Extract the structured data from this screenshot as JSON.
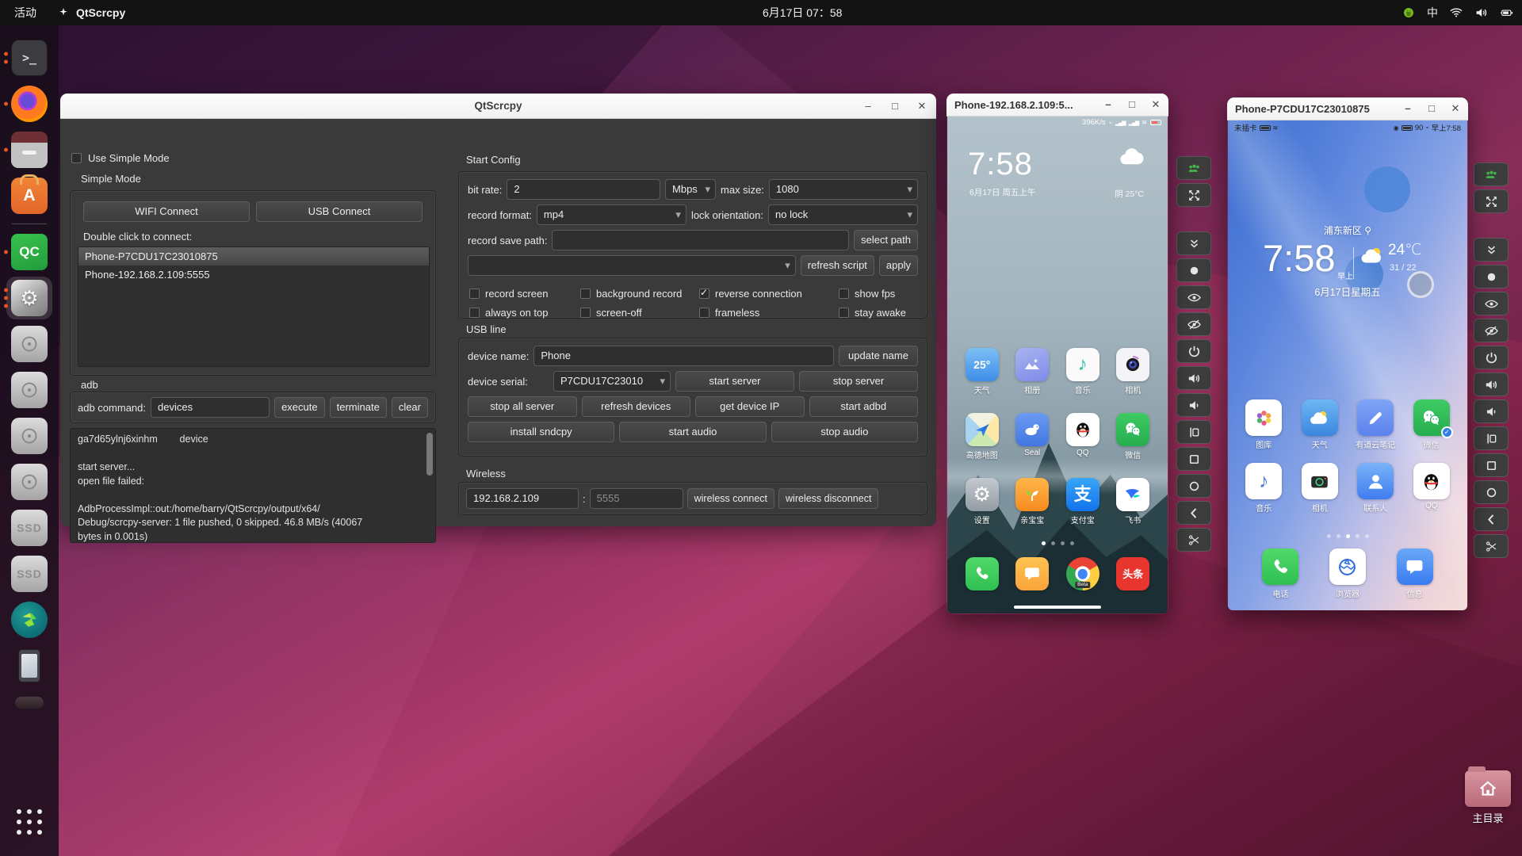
{
  "topbar": {
    "activities_label": "活动",
    "app_name": "QtScrcpy",
    "clock": "6月17日 07：58",
    "ime_label": "中",
    "tray_icons": [
      "android-status-icon",
      "ime-icon",
      "wifi-icon",
      "volume-icon",
      "battery-icon"
    ]
  },
  "dock": {
    "items": [
      {
        "id": "terminal",
        "type": "terminal",
        "dots": 2
      },
      {
        "id": "firefox",
        "type": "firefox",
        "dots": 1
      },
      {
        "id": "files",
        "type": "files",
        "dots": 1
      },
      {
        "id": "ubuntu-software",
        "type": "soft",
        "label": "A",
        "dots": 0
      },
      {
        "id": "divider",
        "type": "divider",
        "dots": 0
      },
      {
        "id": "qtscrcpy-qc",
        "type": "qc",
        "label": "QC",
        "dots": 1
      },
      {
        "id": "settings",
        "type": "gear",
        "dots": 3,
        "active": true
      },
      {
        "id": "disk-1",
        "type": "disk",
        "dots": 0
      },
      {
        "id": "disk-2",
        "type": "disk",
        "dots": 0
      },
      {
        "id": "disk-3",
        "type": "disk",
        "dots": 0
      },
      {
        "id": "disk-4",
        "type": "disk",
        "dots": 0
      },
      {
        "id": "ssd-1",
        "type": "ssd",
        "label": "SSD",
        "dots": 0
      },
      {
        "id": "ssd-2",
        "type": "ssd",
        "label": "SSD",
        "dots": 0
      },
      {
        "id": "remote-app",
        "type": "remote",
        "dots": 0
      },
      {
        "id": "phone-device",
        "type": "phonedev",
        "dots": 0
      },
      {
        "id": "drive-pill",
        "type": "pill",
        "dots": 0
      },
      {
        "id": "app-grid",
        "type": "grid",
        "dots": 0
      }
    ]
  },
  "qtscrcpy": {
    "title": "QtScrcpy",
    "left": {
      "use_simple_mode": "Use Simple Mode",
      "simple_mode_label": "Simple Mode",
      "wifi_connect": "WIFI Connect",
      "usb_connect": "USB Connect",
      "double_click_label": "Double click to connect:",
      "devices": [
        "Phone-P7CDU17C23010875",
        "Phone-192.168.2.109:5555"
      ],
      "adb_label": "adb",
      "adb_command_label": "adb command:",
      "adb_command_value": "devices",
      "execute": "execute",
      "terminate": "terminate",
      "clear": "clear",
      "log_lines": [
        "ga7d65ylnj6xinhm        device",
        "",
        "start server...",
        "open file failed:",
        "",
        "AdbProcessImpl::out:/home/barry/QtScrcpy/output/x64/",
        "Debug/scrcpy-server: 1 file pushed, 0 skipped. 46.8 MB/s (40067",
        "bytes in 0.001s)"
      ]
    },
    "right": {
      "start_config_label": "Start Config",
      "bit_rate_label": "bit rate:",
      "bit_rate_value": "2",
      "bit_rate_unit": "Mbps",
      "max_size_label": "max size:",
      "max_size_value": "1080",
      "record_format_label": "record format:",
      "record_format_value": "mp4",
      "lock_orientation_label": "lock orientation:",
      "lock_orientation_value": "no lock",
      "record_save_path_label": "record save path:",
      "record_save_path_value": "",
      "select_path": "select path",
      "script_value": "",
      "refresh_script": "refresh script",
      "apply": "apply",
      "checkboxes": [
        {
          "label": "record screen",
          "checked": false
        },
        {
          "label": "background record",
          "checked": false
        },
        {
          "label": "reverse connection",
          "checked": true
        },
        {
          "label": "show fps",
          "checked": false
        },
        {
          "label": "always on top",
          "checked": false
        },
        {
          "label": "screen-off",
          "checked": false
        },
        {
          "label": "frameless",
          "checked": false
        },
        {
          "label": "stay awake",
          "checked": false
        }
      ],
      "usb_line_label": "USB line",
      "device_name_label": "device name:",
      "device_name_value": "Phone",
      "update_name": "update name",
      "device_serial_label": "device serial:",
      "device_serial_value": "P7CDU17C23010",
      "server_row": [
        "start server",
        "stop server"
      ],
      "action_row": [
        "stop all server",
        "refresh devices",
        "get device IP",
        "start adbd"
      ],
      "audio_row": [
        "install sndcpy",
        "start audio",
        "stop audio"
      ],
      "wireless_label": "Wireless",
      "wireless_ip": "192.168.2.109",
      "wireless_colon": ":",
      "wireless_port_placeholder": "5555",
      "wireless_connect": "wireless connect",
      "wireless_disconnect": "wireless disconnect"
    }
  },
  "phone1": {
    "title": "Phone-192.168.2.109:5...",
    "status_right_text": "396K/s",
    "clock": "7:58",
    "date": "6月17日 周五上午",
    "weather": "阴  25°C",
    "accent": "#2bbfa3",
    "apps_rows": [
      [
        {
          "label": "天气",
          "glyph": "25°",
          "color": "#fff",
          "fs": 14,
          "bg": "linear-gradient(180deg,#7cc0f5,#3e8de8)"
        },
        {
          "label": "相册",
          "icon": "mountain",
          "bg": "linear-gradient(160deg,#a8b4f0,#7f8ae8)"
        },
        {
          "label": "音乐",
          "glyph": "♪",
          "color": "#2bbfa3",
          "fs": 24,
          "bg": "#fafafa"
        },
        {
          "label": "相机",
          "icon": "camera-lens",
          "bg": "#f4f4f6"
        }
      ],
      [
        {
          "label": "高德地图",
          "icon": "map-plane",
          "bg": "conic-gradient(from 45deg,#ffe9a8 0 25%,#cde8b0 0 50%,#a8d4f0 0 75%,#f2f2e0 0 100%)"
        },
        {
          "label": "Seal",
          "icon": "seal",
          "bg": "linear-gradient(180deg,#6b9af2,#4377e0)"
        },
        {
          "label": "QQ",
          "icon": "penguin",
          "bg": "#ffffff"
        },
        {
          "label": "微信",
          "icon": "wechat",
          "bg": "linear-gradient(180deg,#3ecb63,#26ad4f)"
        }
      ],
      [
        {
          "label": "设置",
          "glyph": "⚙",
          "color": "#ffffff",
          "fs": 25,
          "bg": "linear-gradient(180deg,#c3c9cf,#939ba3)"
        },
        {
          "label": "亲宝宝",
          "icon": "sprout",
          "bg": "linear-gradient(180deg,#ffb64a,#f68b1f)"
        },
        {
          "label": "支付宝",
          "glyph": "支",
          "color": "#fff",
          "fs": 22,
          "bg": "linear-gradient(180deg,#38a6f8,#1273eb)"
        },
        {
          "label": "飞书",
          "icon": "bird",
          "bg": "#ffffff"
        }
      ]
    ],
    "dock_apps": [
      {
        "label": "电话",
        "icon": "phone-call",
        "color": "#fff",
        "bg": "linear-gradient(180deg,#51d96a,#2fbf52)"
      },
      {
        "label": "短信",
        "icon": "bubble",
        "color": "#fff",
        "bg": "linear-gradient(180deg,#ffc352,#f9a43a)"
      },
      {
        "label": "Chrome",
        "cls": "g-chrome",
        "label_in": "Beta",
        "bg": ""
      },
      {
        "label": "头条",
        "glyph": "头条",
        "color": "#fff",
        "fs": 13,
        "bg": "#e8352e"
      }
    ],
    "page_dots": 4,
    "active_dot": 0
  },
  "phone2": {
    "title": "Phone-P7CDU17C23010875",
    "status_left_text": "未插卡",
    "battery_text": "90",
    "time_text": "早上7:58",
    "location": "浦东新区",
    "clock": "7:58",
    "ampm": "早上",
    "temp": "24℃",
    "temp_range": "31 / 22",
    "date": "6月17日星期五",
    "apps_rows": [
      [
        {
          "label": "图库",
          "icon": "flower",
          "bg": "#ffffff"
        },
        {
          "label": "天气",
          "icon": "sun-cloud",
          "bg": "linear-gradient(180deg,#6db7f2,#3a86e0)"
        },
        {
          "label": "有道云笔记",
          "icon": "pencil",
          "color": "#fff",
          "bg": "linear-gradient(180deg,#7fa4f5,#5c82ee)"
        },
        {
          "label": "微信",
          "icon": "wechat",
          "badge": true,
          "bg": "linear-gradient(180deg,#3ecb63,#26ad4f)"
        }
      ],
      [
        {
          "label": "音乐",
          "glyph": "♪",
          "color": "#4a7bd8",
          "fs": 25,
          "bg": "#ffffff"
        },
        {
          "label": "相机",
          "icon": "camera-body",
          "bg": "#ffffff"
        },
        {
          "label": "联系人",
          "icon": "person",
          "color": "#fff",
          "bg": "linear-gradient(180deg,#7ab2f8,#3f7df0)"
        },
        {
          "label": "QQ",
          "icon": "penguin",
          "bg": "#ffffff"
        }
      ]
    ],
    "dock_apps": [
      {
        "label": "电话",
        "icon": "phone-call",
        "color": "#fff",
        "bg": "linear-gradient(180deg,#51d96a,#2fbf52)"
      },
      {
        "label": "浏览器",
        "icon": "globe",
        "color": "#2f6fe0",
        "bg": "#ffffff"
      },
      {
        "label": "信息",
        "icon": "bubble",
        "color": "#fff",
        "bg": "linear-gradient(180deg,#6aa8f8,#3a7bf0)"
      }
    ],
    "page_dots": 5,
    "active_dot": 2
  },
  "phone_toolbar": {
    "buttons": [
      "people-group",
      "fullscreen",
      "collapse",
      "dot",
      "eye",
      "eye-off",
      "power",
      "volume-up",
      "volume-down",
      "app-switch",
      "menu-square",
      "home-circle",
      "back",
      "scissors"
    ]
  },
  "home_shortcut": {
    "label": "主目录"
  }
}
